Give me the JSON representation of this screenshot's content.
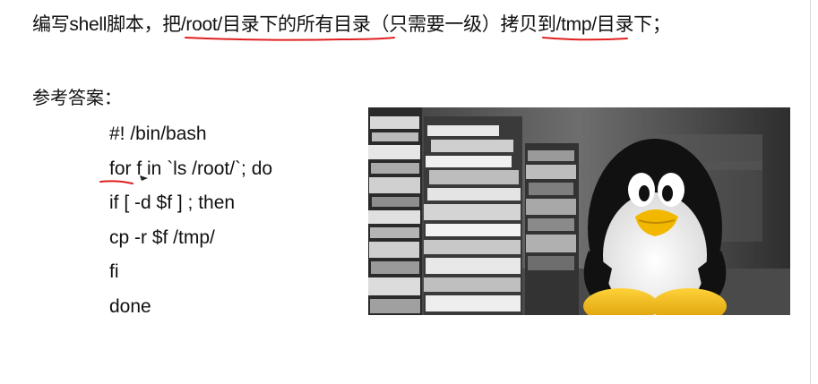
{
  "question": {
    "text_1": "编写shell脚本，把",
    "text_2": "/root/目录下的所有目录",
    "text_3": "（只需要一级）",
    "text_4": "拷贝到",
    "text_5": "/tmp/",
    "text_6": "目录下；"
  },
  "answer": {
    "label": "参考答案：",
    "code_lines": [
      "#! /bin/bash",
      "for f in `ls /root/`; do",
      "if [ -d $f ] ; then",
      "cp -r $f /tmp/",
      "fi",
      "done"
    ]
  },
  "image": {
    "subject": "tux-penguin-with-books"
  },
  "colors": {
    "annotation_red": "#e02020",
    "text": "#111111"
  }
}
